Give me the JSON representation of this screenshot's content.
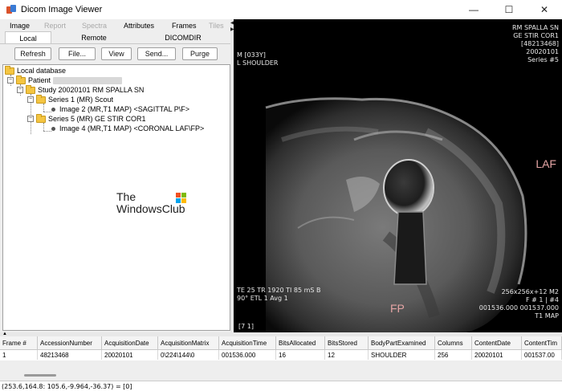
{
  "window": {
    "title": "Dicom Image Viewer",
    "minimize_glyph": "—",
    "maximize_glyph": "☐",
    "close_glyph": "✕"
  },
  "tabs_row1": [
    {
      "label": "Image",
      "enabled": true
    },
    {
      "label": "Report",
      "enabled": false
    },
    {
      "label": "Spectra",
      "enabled": false
    },
    {
      "label": "Attributes",
      "enabled": true
    },
    {
      "label": "Frames",
      "enabled": true
    },
    {
      "label": "Tiles",
      "enabled": false
    }
  ],
  "tabs_row2": [
    {
      "label": "Local",
      "active": true
    },
    {
      "label": "Remote",
      "active": false
    },
    {
      "label": "DICOMDIR",
      "active": false
    }
  ],
  "toolbar": {
    "refresh": "Refresh",
    "file": "File...",
    "view": "View",
    "send": "Send...",
    "purge": "Purge"
  },
  "tree": {
    "root": "Local database",
    "patient": "Patient",
    "study": "Study 20020101 RM SPALLA SN",
    "series1": "Series 1 (MR) Scout",
    "image2": "Image 2 (MR,T1 MAP) <SAGITTAL P\\F>",
    "series5": "Series 5 (MR) GE STIR COR1",
    "image4": "Image 4 (MR,T1 MAP) <CORONAL LAF\\FP>",
    "minus_glyph": "−"
  },
  "watermark": {
    "line1": "The",
    "line2": "WindowsClub"
  },
  "overlay": {
    "top_right": [
      "RM SPALLA SN",
      "GE STIR COR1",
      "[48213468]",
      "20020101",
      "Series #5"
    ],
    "top_left": [
      "M  [033Y]",
      "L SHOULDER"
    ],
    "bottom_left": [
      "TE 25 TR 1920 TI 85 mS B",
      "90° ETL 1 Avg 1"
    ],
    "bottom_left2": "[7 1]",
    "bottom_right": [
      "256x256x+12 M2",
      "F # 1 | #4",
      "001536.000 001537.000",
      "T1 MAP"
    ],
    "orient_right": "LAF",
    "orient_bottom": "FP"
  },
  "attributes_table": {
    "columns": [
      "Frame #",
      "AccessionNumber",
      "AcquisitionDate",
      "AcquisitionMatrix",
      "AcquisitionTime",
      "BitsAllocated",
      "BitsStored",
      "BodyPartExamined",
      "Columns",
      "ContentDate",
      "ContentTim"
    ],
    "rows": [
      [
        "1",
        "48213468",
        "20020101",
        "0\\224\\144\\0",
        "001536.000",
        "16",
        "12",
        "SHOULDER",
        "256",
        "20020101",
        "001537.00"
      ]
    ]
  },
  "status_bar": "(253.6,164.8: 105.6,-9.964,-36.37) = [0]",
  "colors": {
    "folder": "#f4c542",
    "overlay_text": "#e8e8e8",
    "orientation_label": "#e5a5a5"
  }
}
